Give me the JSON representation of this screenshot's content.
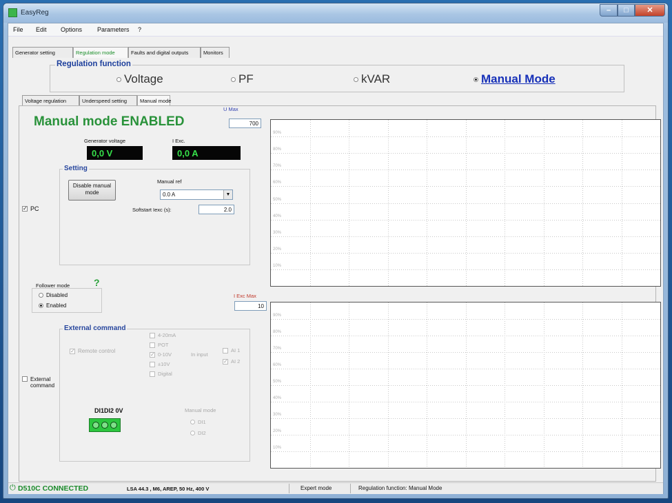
{
  "window": {
    "title": "EasyReg"
  },
  "menu": [
    "File",
    "Edit",
    "Options",
    "Parameters",
    "?"
  ],
  "main_tabs": [
    "Generator setting",
    "Regulation mode",
    "Faults and digital outputs",
    "Monitors"
  ],
  "regulation_function": {
    "title": "Regulation function",
    "options": [
      "Voltage",
      "PF",
      "kVAR",
      "Manual Mode"
    ],
    "selected": "Manual Mode"
  },
  "sub_tabs": [
    "Voltage regulation",
    "Underspeed setting",
    "Manual mode"
  ],
  "manual": {
    "title": "Manual mode ENABLED",
    "gen_voltage_label": "Generator voltage",
    "gen_voltage_value": "0,0 V",
    "iexc_label": "I Exc.",
    "iexc_value": "0,0 A",
    "setting_title": "Setting",
    "disable_button_line1": "Disable manual",
    "disable_button_line2": "mode",
    "manual_ref_label": "Manual ref",
    "manual_ref_value": "0.0 A",
    "softstart_label": "Softstart Iexc (s):",
    "softstart_value": "2.0",
    "pc_label": "PC",
    "pc_checked": true
  },
  "follower": {
    "title": "Follower mode",
    "help": "?",
    "options": [
      "Disabled",
      "Enabled"
    ],
    "selected": "Enabled"
  },
  "external": {
    "checkbox_line1": "External",
    "checkbox_line2": "command",
    "group_title": "External command",
    "remote_control": "Remote control",
    "signals": [
      "4-20mA",
      "POT",
      "0-10V",
      "±10V",
      "Digital"
    ],
    "signals_checked": [
      false,
      false,
      true,
      false,
      false
    ],
    "in_input": "In input",
    "inputs": [
      "AI 1",
      "AI 2"
    ],
    "inputs_checked": [
      false,
      true
    ],
    "connector_label": "DI1DI2 0V",
    "manual_mode_label": "Manual mode",
    "manual_mode_options": [
      "DI1",
      "DI2"
    ]
  },
  "chart_umax": {
    "label": "U Max",
    "value": "700",
    "ticks": [
      "90%",
      "80%",
      "70%",
      "60%",
      "50%",
      "40%",
      "30%",
      "20%",
      "10%"
    ]
  },
  "chart_iexcmax": {
    "label": "I Exc Max",
    "value": "10",
    "ticks": [
      "90%",
      "80%",
      "70%",
      "60%",
      "50%",
      "40%",
      "30%",
      "20%",
      "10%"
    ]
  },
  "status": {
    "connected": "D510C CONNECTED",
    "device": "LSA 44.3 , M6, AREP, 50 Hz, 400 V",
    "mode": "Expert mode",
    "reg_function": "Regulation function: Manual Mode"
  },
  "colors": {
    "accent_green": "#29923a",
    "title_blue": "#1d3f9c",
    "link_blue": "#1630b8",
    "lcd_text": "#36e04a"
  }
}
